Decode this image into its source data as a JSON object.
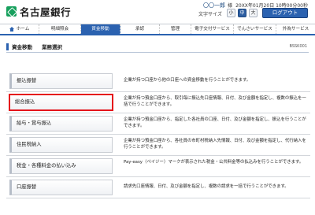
{
  "header": {
    "bank_name": "名古屋銀行",
    "user_name": "〇〇一郎",
    "honorific": "様",
    "last_login": "20XX年01月20日 10時00分00秒",
    "font_size_label": "文字サイズ",
    "font_sizes": [
      "小",
      "中",
      "大"
    ],
    "active_font_size": "中",
    "logout_label": "ログアウト"
  },
  "nav": {
    "items": [
      {
        "label": "ホーム",
        "icon": "home-icon"
      },
      {
        "label": "明細照会"
      },
      {
        "label": "資金移動",
        "active": true
      },
      {
        "label": "承認"
      },
      {
        "label": "管理"
      },
      {
        "label": "電子交付サービス"
      },
      {
        "label": "でんさいサービス"
      },
      {
        "label": "外為サービス"
      }
    ]
  },
  "page": {
    "section": "資金移動",
    "subtitle": "業務選択",
    "screen_id": "BSSK001"
  },
  "menu": [
    {
      "label": "振込振替",
      "description": "企業が持つ口座から他の口座への資金移動を行うことができます。"
    },
    {
      "label": "総合振込",
      "description": "企業が持つ預金口座から、取引毎に振込先口座情報、日付、及び金額を指定し、複数の振込を一括で行うことができます。",
      "selected": true
    },
    {
      "label": "給与・賞与振込",
      "description": "企業が持つ預金口座から、指定した各社員の口座、日付、及び金額を指定し、振込を行うことができます。"
    },
    {
      "label": "住民税納入",
      "description": "企業が持つ預金口座から、各社員の市町村税納入先情報、日付、及び金額を指定し、代行納入を行うことができます。"
    },
    {
      "label": "税金・各種料金の払い込み",
      "description": "Pay-easy（ペイジー）マークが表示された税金・公共料金等の払込みを行うことができます。"
    },
    {
      "label": "口座振替",
      "description": "請求先口座情報、日付、及び金額を指定し、複数の請求を一括で行うことができます。"
    }
  ],
  "colors": {
    "brand_green": "#17a05d",
    "nav_blue": "#2b62b0",
    "selection_red": "#e5141b"
  }
}
